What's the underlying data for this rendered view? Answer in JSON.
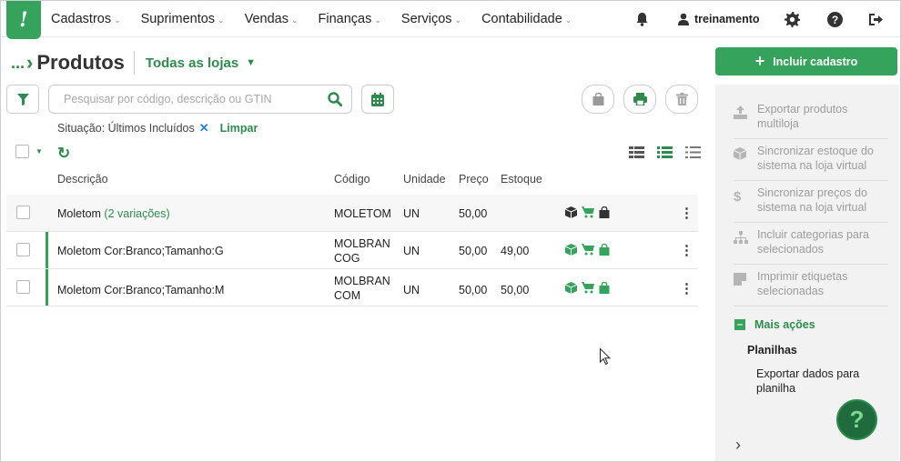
{
  "app": {
    "logo_glyph": "!",
    "brand_color": "#35a35b"
  },
  "menu": {
    "items": [
      "Cadastros",
      "Suprimentos",
      "Vendas",
      "Finanças",
      "Serviços",
      "Contabilidade"
    ]
  },
  "user": {
    "name": "treinamento"
  },
  "header": {
    "breadcrumb_dots": "...",
    "title": "Produtos",
    "store_selector": "Todas as lojas"
  },
  "search": {
    "placeholder": "Pesquisar por código, descrição ou GTIN",
    "value": ""
  },
  "filter": {
    "label": "Situação: Últimos Incluídos",
    "remove_glyph": "✕",
    "clear_label": "Limpar"
  },
  "table": {
    "columns": [
      "Descrição",
      "Código",
      "Unidade",
      "Preço",
      "Estoque"
    ],
    "rows": [
      {
        "descricao": "Moletom",
        "variacoes": "(2 variações)",
        "codigo_l1": "MOLETOM",
        "codigo_l2": "",
        "unidade": "UN",
        "preco": "50,00",
        "estoque": "",
        "icon_color": "#333333"
      },
      {
        "descricao": "Moletom Cor:Branco;Tamanho:G",
        "variacoes": "",
        "codigo_l1": "MOLBRAN",
        "codigo_l2": "COG",
        "unidade": "UN",
        "preco": "50,00",
        "estoque": "49,00",
        "icon_color": "#35a35b"
      },
      {
        "descricao": "Moletom Cor:Branco;Tamanho:M",
        "variacoes": "",
        "codigo_l1": "MOLBRAN",
        "codigo_l2": "COM",
        "unidade": "UN",
        "preco": "50,00",
        "estoque": "50,00",
        "icon_color": "#35a35b"
      }
    ]
  },
  "sidebar": {
    "include_button": "Incluir cadastro",
    "items": [
      {
        "label_l1": "Exportar produtos",
        "label_l2": "multiloja",
        "icon": "upload-icon"
      },
      {
        "label_l1": "Sincronizar estoque do",
        "label_l2": "sistema na loja virtual",
        "icon": "box-icon"
      },
      {
        "label_l1": "Sincronizar preços do",
        "label_l2": "sistema na loja virtual",
        "icon": "dollar-icon"
      },
      {
        "label_l1": "Incluir categorias para",
        "label_l2": "selecionados",
        "icon": "sitemap-icon"
      },
      {
        "label_l1": "Imprimir etiquetas",
        "label_l2": "selecionadas",
        "icon": "label-icon"
      }
    ],
    "more_actions": "Mais ações",
    "section_title": "Planilhas",
    "export_sheet_l1": "Exportar dados para",
    "export_sheet_l2": "planilha",
    "help_glyph": "?"
  }
}
